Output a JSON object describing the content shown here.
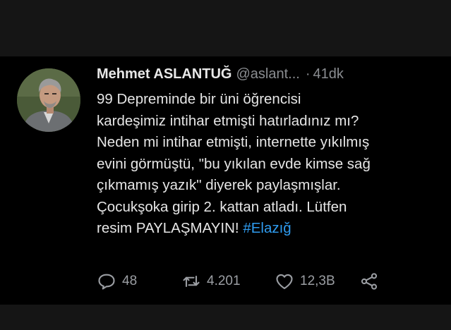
{
  "tweet": {
    "author_name": "Mehmet ASLANTUĞ",
    "handle": "@aslant...",
    "separator": "·",
    "time": "41dk",
    "lines": [
      "99 Depreminde bir üni öğrencisi",
      "kardeşimiz intihar etmişti hatırladınız mı?",
      "Neden mi intihar etmişti, internette yıkılmış",
      "evini görmüştü, \"bu yıkılan evde kimse sağ",
      "çıkmamış yazık\" diyerek paylaşmışlar.",
      "Çocukşoka girip 2. kattan atladı. Lütfen"
    ],
    "last_line_text": "resim PAYLAŞMAYIN! ",
    "hashtag": "#Elazığ"
  },
  "actions": {
    "replies": "48",
    "retweets": "4.201",
    "likes": "12,3B"
  },
  "colors": {
    "background": "#000000",
    "text": "#e6e6e6",
    "muted": "#8a8d91",
    "link": "#2f9cf0"
  },
  "icons": [
    "reply-icon",
    "retweet-icon",
    "like-icon",
    "share-icon"
  ]
}
